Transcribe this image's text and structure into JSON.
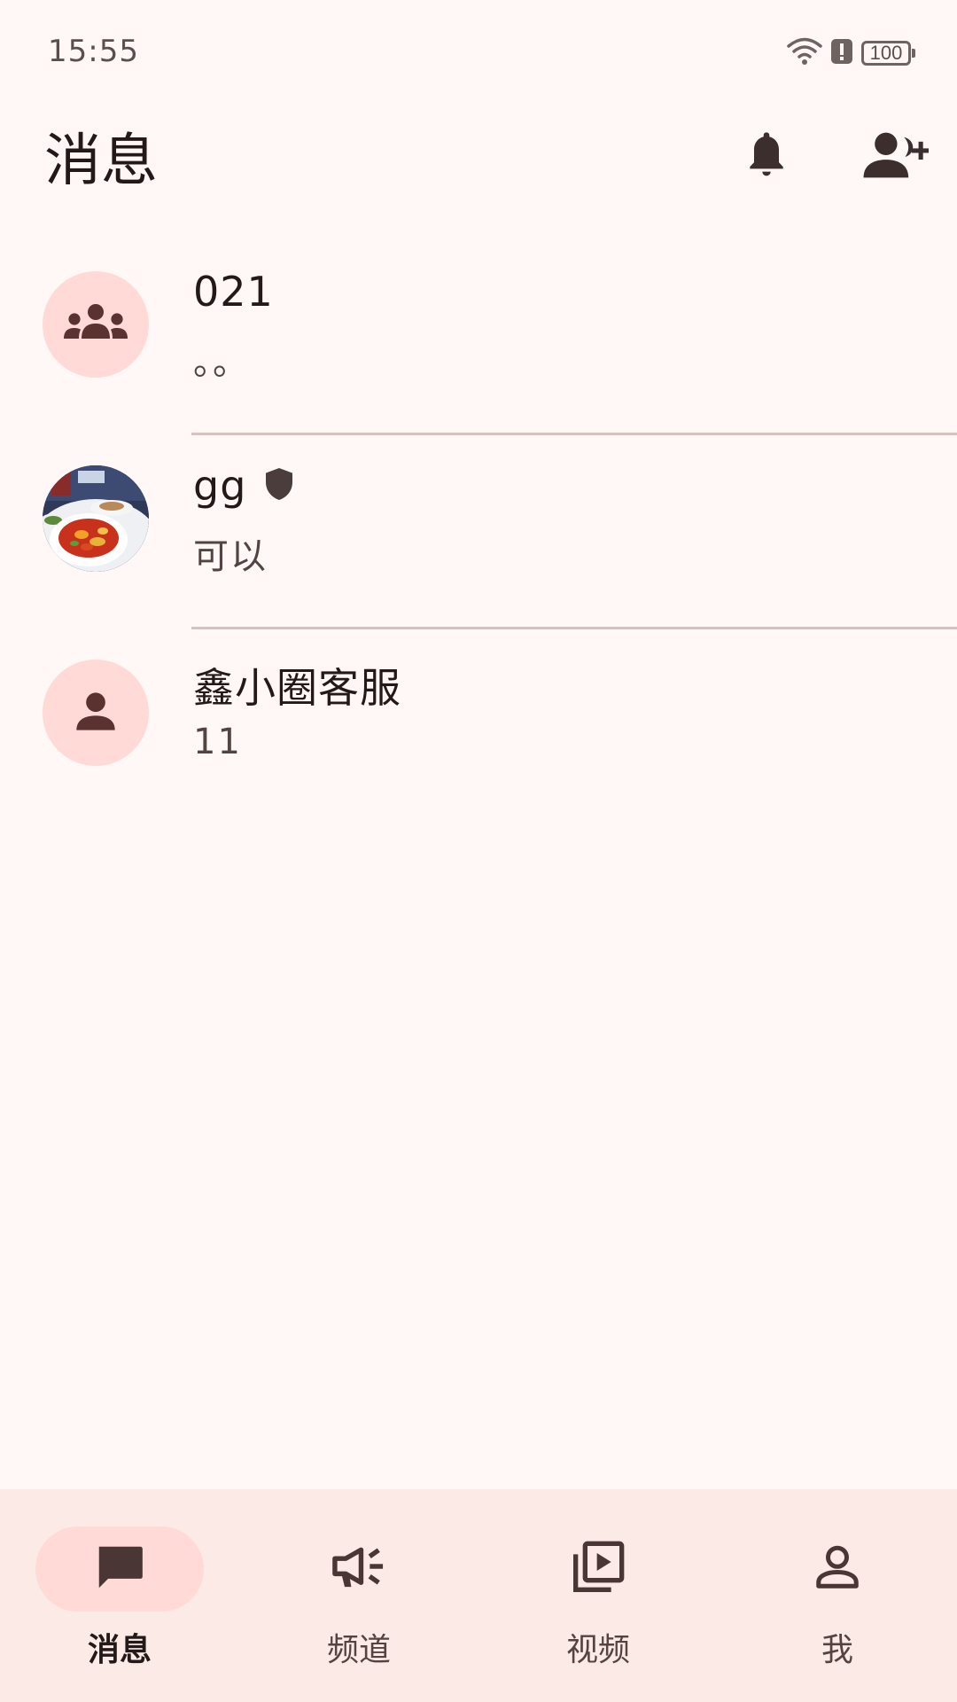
{
  "status_bar": {
    "time": "15:55",
    "battery": "100",
    "icons": [
      "wifi-icon",
      "alert-icon",
      "battery-icon"
    ]
  },
  "header": {
    "title": "消息",
    "actions": [
      "bell-icon",
      "add-friend-icon"
    ]
  },
  "conversations": [
    {
      "name": "021",
      "preview": "。。",
      "avatar": "group-icon",
      "badge": ""
    },
    {
      "name": "gg",
      "preview": "可以",
      "avatar": "photo-avatar",
      "badge": "shield-icon"
    },
    {
      "name": "鑫小圈客服",
      "preview": "11",
      "avatar": "person-icon",
      "badge": ""
    }
  ],
  "bottom_nav": {
    "items": [
      {
        "label": "消息",
        "icon": "chat-icon",
        "active": true
      },
      {
        "label": "频道",
        "icon": "megaphone-icon",
        "active": false
      },
      {
        "label": "视频",
        "icon": "video-library-icon",
        "active": false
      },
      {
        "label": "我",
        "icon": "person-outline-icon",
        "active": false
      }
    ]
  },
  "colors": {
    "background": "#FFF8F6",
    "avatar_bg": "#FFDAD6",
    "icon_dark": "#5A3330",
    "nav_bg": "#FCEAE7",
    "divider": "#D8C2BF"
  }
}
